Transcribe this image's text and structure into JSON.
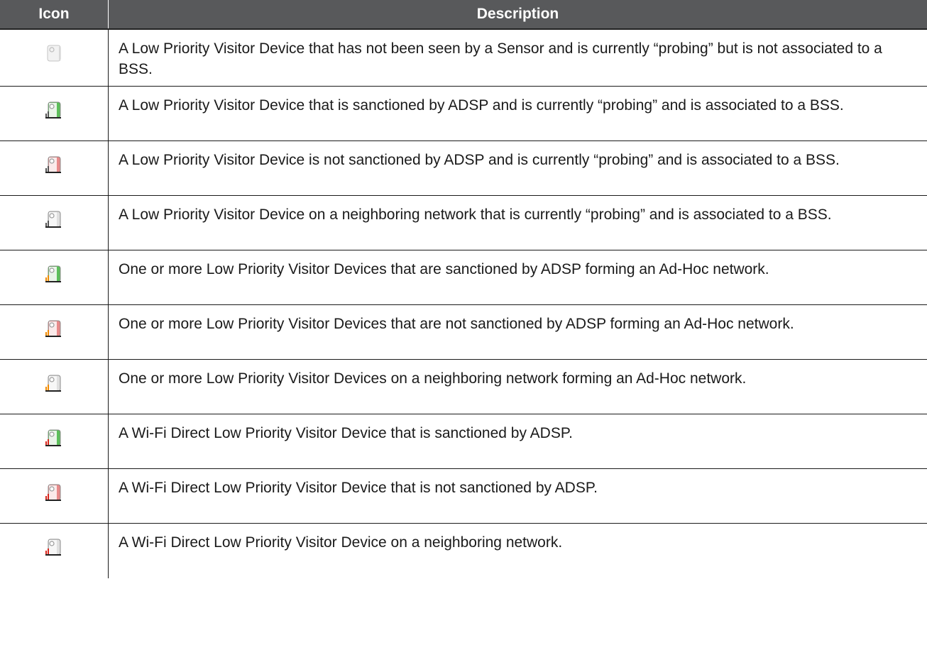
{
  "header": {
    "icon_label": "Icon",
    "description_label": "Description"
  },
  "colors": {
    "header_bg": "#58595b",
    "sanctioned": "#5cbf5a",
    "unsanctioned": "#e88a8a",
    "neighboring": "#e0e0e0",
    "antenna_gray": "#555555",
    "antenna_orange": "#f08a00",
    "antenna_red": "#d8261c"
  },
  "rows": [
    {
      "icon": "visitor-device-unseen-icon",
      "description": "A Low Priority Visitor Device that has not been seen by a Sensor and is currently “probing” but is not associated to a BSS."
    },
    {
      "icon": "visitor-device-sanctioned-bss-icon",
      "description": "A Low Priority Visitor Device that is sanctioned by ADSP and is currently “probing” and is associated to a BSS."
    },
    {
      "icon": "visitor-device-unsanctioned-bss-icon",
      "description": "A Low Priority Visitor Device is not sanctioned by ADSP and is currently “probing” and is associated to a BSS."
    },
    {
      "icon": "visitor-device-neighboring-bss-icon",
      "description": "A Low Priority Visitor Device on a neighboring network that is currently “probing” and is associated to a BSS."
    },
    {
      "icon": "visitor-device-sanctioned-adhoc-icon",
      "description": "One or more Low Priority Visitor Devices that are sanctioned by ADSP forming an Ad-Hoc network."
    },
    {
      "icon": "visitor-device-unsanctioned-adhoc-icon",
      "description": "One or more Low Priority Visitor Devices that are not sanctioned by ADSP forming an Ad-Hoc network."
    },
    {
      "icon": "visitor-device-neighboring-adhoc-icon",
      "description": "One or more Low Priority Visitor Devices on a neighboring network forming an Ad-Hoc network."
    },
    {
      "icon": "visitor-device-sanctioned-wifi-direct-icon",
      "description": "A Wi-Fi Direct Low Priority Visitor Device that is sanctioned by ADSP."
    },
    {
      "icon": "visitor-device-unsanctioned-wifi-direct-icon",
      "description": "A Wi-Fi Direct Low Priority Visitor Device that is not sanctioned by ADSP."
    },
    {
      "icon": "visitor-device-neighboring-wifi-direct-icon",
      "description": "A Wi-Fi Direct Low Priority Visitor Device on a neighboring network."
    }
  ]
}
